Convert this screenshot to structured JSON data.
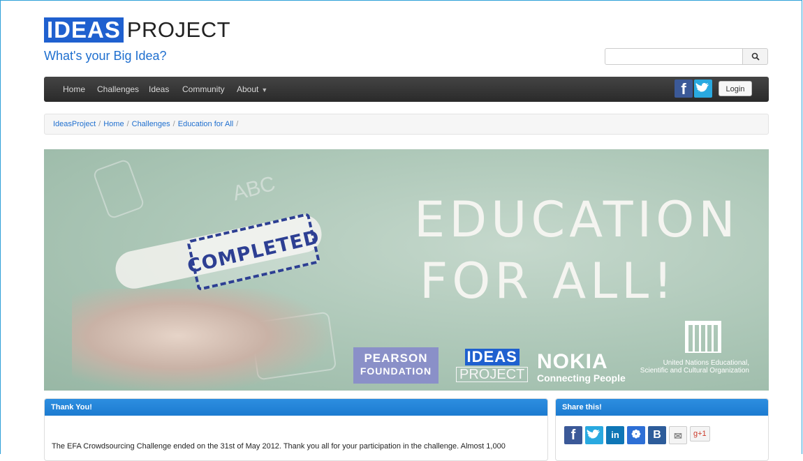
{
  "header": {
    "logo_ideas": "IDEAS",
    "logo_project": "PROJECT",
    "tagline": "What's your Big Idea?",
    "search": {
      "placeholder": "",
      "button_icon": "search-icon"
    }
  },
  "nav": {
    "items": [
      "Home",
      "Challenges",
      "Ideas",
      "Community",
      "About"
    ],
    "facebook_icon": "facebook-icon",
    "twitter_icon": "twitter-icon",
    "login_label": "Login"
  },
  "breadcrumb": [
    "IdeasProject",
    "Home",
    "Challenges",
    "Education for All"
  ],
  "banner": {
    "stamp": "COMPLETED",
    "headline_line1": "EDUCATION",
    "headline_line2": "FOR ALL!",
    "pearson_line1": "PEARSON",
    "pearson_line2": "FOUNDATION",
    "ideas": "IDEAS",
    "project": "PROJECT",
    "nokia": "NOKIA",
    "nokia_tagline": "Connecting People",
    "unesco_line1": "United Nations Educational,",
    "unesco_line2": "Scientific and Cultural Organization"
  },
  "thanks_panel": {
    "title": "Thank You!",
    "text": "The EFA Crowdsourcing Challenge ended on the 31st of May 2012. Thank you all for your participation in the challenge. Almost 1,000"
  },
  "share_panel": {
    "title": "Share this!",
    "icons": [
      "facebook-icon",
      "twitter-icon",
      "linkedin-icon",
      "baidu-icon",
      "b-icon",
      "mail-icon"
    ],
    "gplus_label": "+1"
  },
  "colors": {
    "accent": "#1f6fcf",
    "panel_header": "#2d8ee0",
    "navbar": "#333333"
  }
}
